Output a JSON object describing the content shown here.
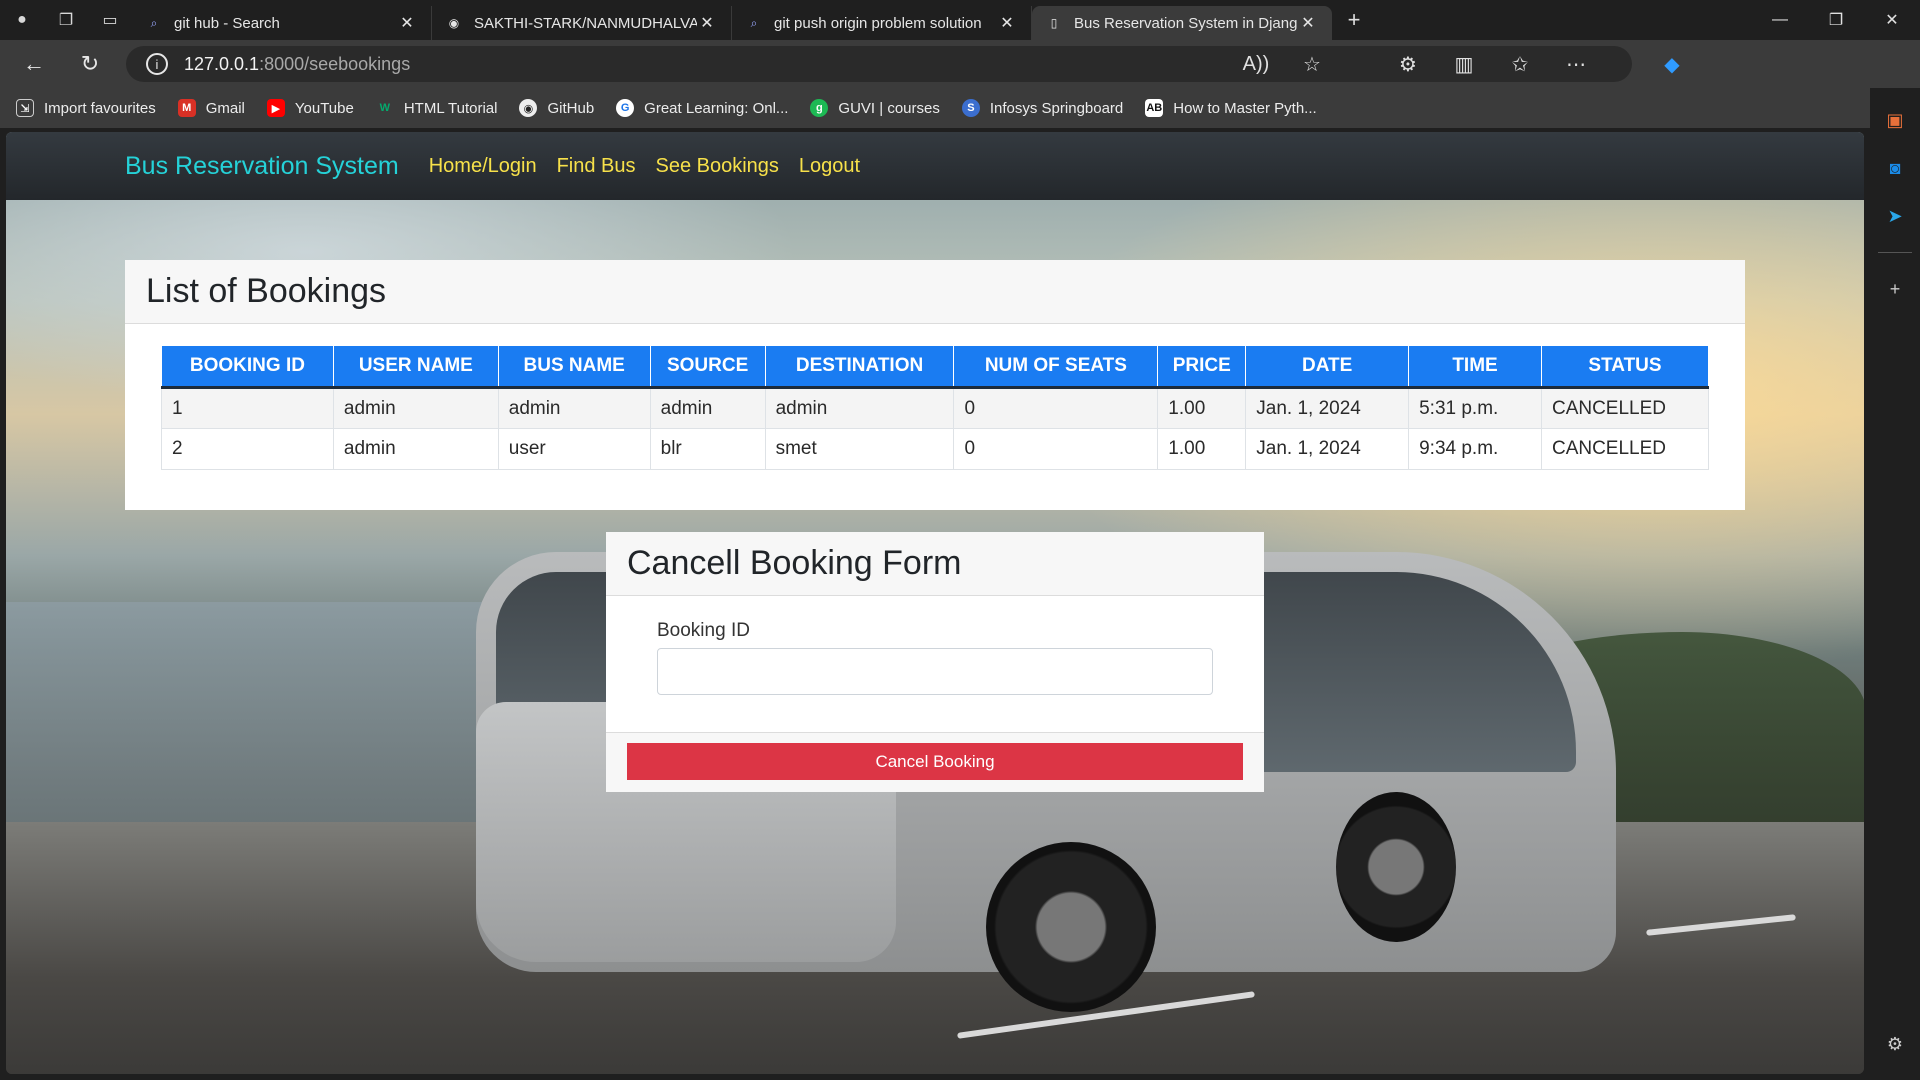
{
  "browser": {
    "tabs": [
      {
        "title": "git hub - Search",
        "icon": "search-icon"
      },
      {
        "title": "SAKTHI-STARK/NANMUDHALVAN",
        "icon": "github-icon"
      },
      {
        "title": "git push origin problem solution",
        "icon": "search-icon"
      },
      {
        "title": "Bus Reservation System in Django",
        "icon": "page-icon",
        "active": true
      }
    ],
    "url_host": "127.0.0.1",
    "url_path": ":8000/seebookings",
    "bookmarks": [
      {
        "label": "Import favourites",
        "icon": "import-icon",
        "color": "#3b3b3b"
      },
      {
        "label": "Gmail",
        "icon": "gmail-icon",
        "color": "#d93025"
      },
      {
        "label": "YouTube",
        "icon": "youtube-icon",
        "color": "#ff0000"
      },
      {
        "label": "HTML Tutorial",
        "icon": "w3schools-icon",
        "color": "#04aa6d"
      },
      {
        "label": "GitHub",
        "icon": "github-icon",
        "color": "#3b3b3b"
      },
      {
        "label": "Great Learning: Onl...",
        "icon": "great-learning-icon",
        "color": "#ffffff"
      },
      {
        "label": "GUVI | courses",
        "icon": "guvi-icon",
        "color": "#1db954"
      },
      {
        "label": "Infosys Springboard",
        "icon": "infosys-icon",
        "color": "#3b6ecf"
      },
      {
        "label": "How to Master Pyth...",
        "icon": "ab-icon",
        "color": "#111111"
      }
    ]
  },
  "navbar": {
    "brand": "Bus Reservation System",
    "links": [
      "Home/Login",
      "Find Bus",
      "See Bookings",
      "Logout"
    ]
  },
  "bookings": {
    "title": "List of Bookings",
    "columns": [
      "BOOKING ID",
      "USER NAME",
      "BUS NAME",
      "SOURCE",
      "DESTINATION",
      "NUM OF SEATS",
      "PRICE",
      "DATE",
      "TIME",
      "STATUS"
    ],
    "rows": [
      [
        "1",
        "admin",
        "admin",
        "admin",
        "admin",
        "0",
        "1.00",
        "Jan. 1, 2024",
        "5:31 p.m.",
        "CANCELLED"
      ],
      [
        "2",
        "admin",
        "user",
        "blr",
        "smet",
        "0",
        "1.00",
        "Jan. 1, 2024",
        "9:34 p.m.",
        "CANCELLED"
      ]
    ]
  },
  "cancel_form": {
    "title": "Cancell Booking Form",
    "label": "Booking ID",
    "value": "",
    "button": "Cancel Booking"
  },
  "colors": {
    "brand": "#25d2d8",
    "nav_link": "#f7e14a",
    "table_header": "#1a7cf2",
    "danger": "#dc3545"
  }
}
